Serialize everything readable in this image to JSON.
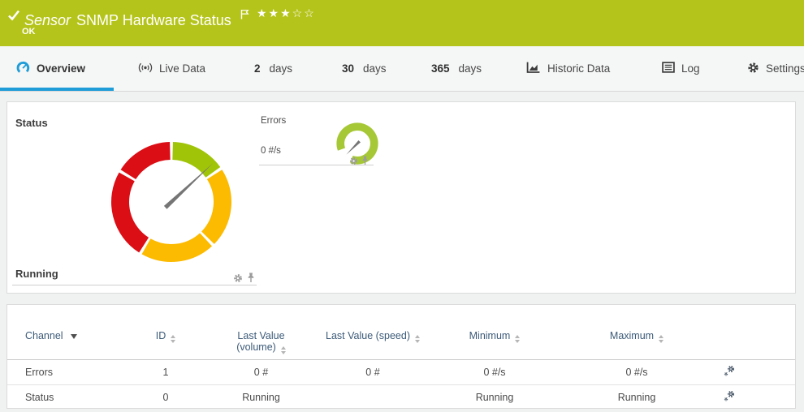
{
  "colors": {
    "header_bg": "#b5c41a",
    "accent_blue": "#1e9dd8",
    "gauge_green": "#a0c408",
    "gauge_yellow": "#fcba00",
    "gauge_red": "#db0d15",
    "mini_gauge_green": "#a6c836",
    "needle_gray": "#757575"
  },
  "header": {
    "kind": "Sensor",
    "title": "SNMP Hardware Status",
    "status": "OK",
    "stars_filled": "★★★",
    "stars_empty": "☆☆"
  },
  "tabs": [
    {
      "label": "Overview",
      "icon": "gauge-icon",
      "active": true
    },
    {
      "label": "Live Data",
      "icon": "broadcast-icon"
    },
    {
      "num": "2",
      "label": "days"
    },
    {
      "num": "30",
      "label": "days"
    },
    {
      "num": "365",
      "label": "days"
    },
    {
      "label": "Historic Data",
      "icon": "area-chart-icon"
    },
    {
      "label": "Log",
      "icon": "log-icon"
    },
    {
      "label": "Settings",
      "icon": "gear-icon"
    }
  ],
  "overview": {
    "status_gauge": {
      "title": "Status",
      "bottom_label": "Running",
      "needle_angle_deg": 47,
      "segments": [
        {
          "color_key": "gauge_green",
          "from_deg": 1.5,
          "to_deg": 54.5
        },
        {
          "color_key": "gauge_yellow",
          "from_deg": 57.5,
          "to_deg": 134.5
        },
        {
          "color_key": "gauge_yellow",
          "from_deg": 137.5,
          "to_deg": 209.5
        },
        {
          "color_key": "gauge_red",
          "from_deg": 212.5,
          "to_deg": 299.5
        },
        {
          "color_key": "gauge_red",
          "from_deg": 302.5,
          "to_deg": 358.5
        }
      ]
    },
    "errors_gauge": {
      "title": "Errors",
      "value": "0 #/s",
      "needle_angle_deg": 225
    }
  },
  "table": {
    "columns": [
      {
        "label": "Channel",
        "sorted": "desc"
      },
      {
        "label": "ID",
        "sortable": true
      },
      {
        "label": "Last Value",
        "label2": "(volume)",
        "sortable": true
      },
      {
        "label": "Last Value (speed)",
        "sortable": true
      },
      {
        "label": "Minimum",
        "sortable": true
      },
      {
        "label": "Maximum",
        "sortable": true
      }
    ],
    "rows": [
      {
        "channel": "Errors",
        "id": "1",
        "last_value_volume": "0 #",
        "last_value_speed": "0 #",
        "minimum": "0 #/s",
        "maximum": "0 #/s"
      },
      {
        "channel": "Status",
        "id": "0",
        "last_value_volume": "Running",
        "last_value_speed": "",
        "minimum": "Running",
        "maximum": "Running"
      }
    ]
  }
}
